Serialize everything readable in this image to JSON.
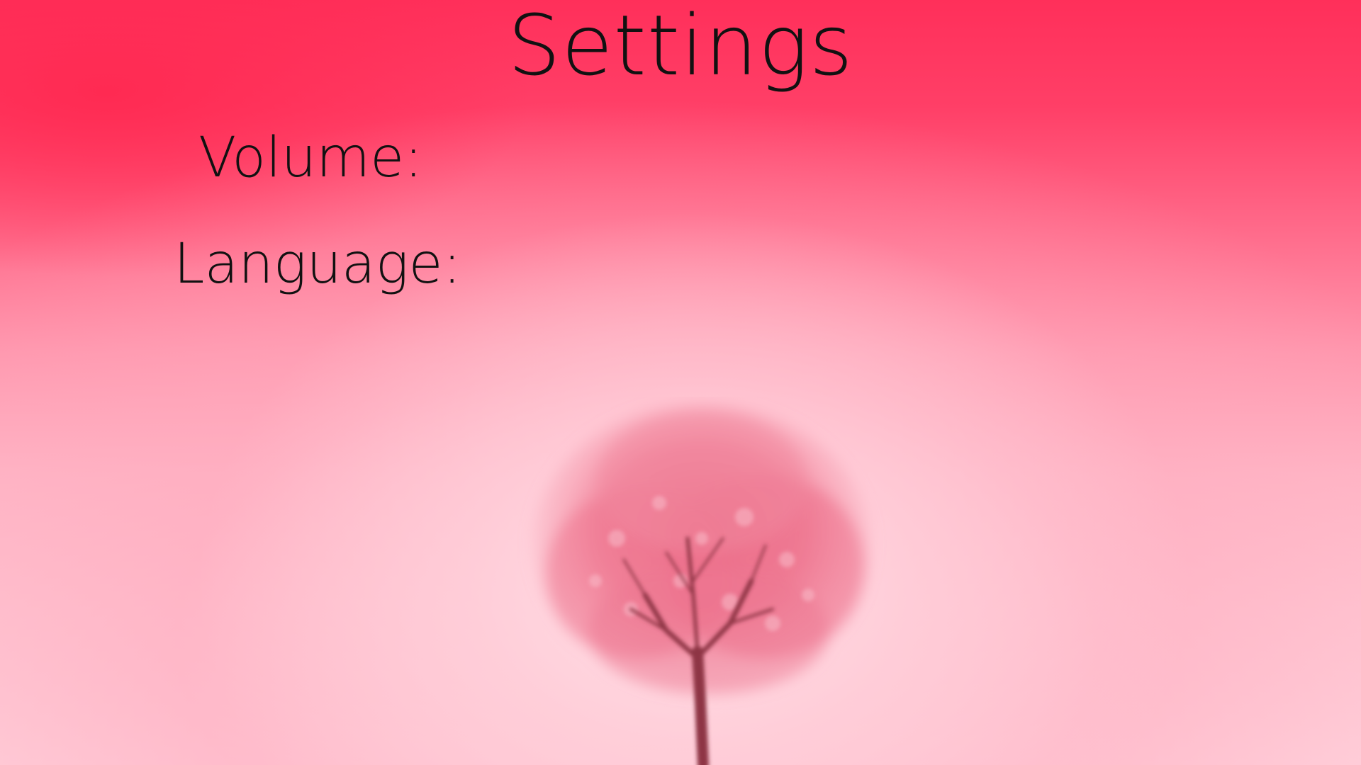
{
  "screen": {
    "title": "Settings"
  },
  "settings": {
    "volume_label": "Volume:",
    "language_label": "Language:"
  },
  "colors": {
    "background_top": "#ff2f5a",
    "background_bottom": "#ffd6df",
    "text": "#111111",
    "tree_blossom": "#f07a93",
    "tree_trunk": "#8e3444"
  },
  "icons": {
    "background_art": "cherry-blossom-tree"
  }
}
